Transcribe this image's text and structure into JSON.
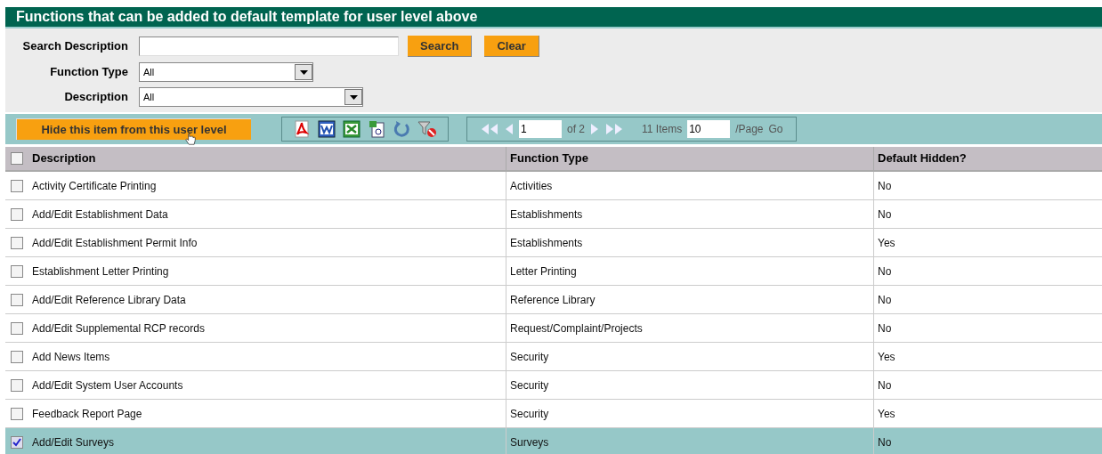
{
  "title": "Functions that can be added to default template for user level above",
  "search": {
    "label": "Search Description",
    "buttons": [
      "Search",
      "Clear"
    ]
  },
  "filters": [
    {
      "label": "Function Type",
      "value": "All"
    },
    {
      "label": "Description",
      "value": "All"
    }
  ],
  "toolbar": {
    "action": "Hide this item from this user level"
  },
  "pager": {
    "page": "1",
    "of": "of 2",
    "items": "11 Items",
    "page_size": "10",
    "per_page": "/Page",
    "go": "Go"
  },
  "table": {
    "select_all_checked": false,
    "columns": [
      "Description",
      "Function Type",
      "Default Hidden?"
    ],
    "rows": [
      {
        "description": "Activity Certificate Printing",
        "function_type": "Activities",
        "default_hidden": "No",
        "checked": false,
        "selected": false
      },
      {
        "description": "Add/Edit Establishment Data",
        "function_type": "Establishments",
        "default_hidden": "No",
        "checked": false,
        "selected": false
      },
      {
        "description": "Add/Edit Establishment Permit Info",
        "function_type": "Establishments",
        "default_hidden": "Yes",
        "checked": false,
        "selected": false
      },
      {
        "description": "Establishment Letter Printing",
        "function_type": "Letter Printing",
        "default_hidden": "No",
        "checked": false,
        "selected": false
      },
      {
        "description": "Add/Edit Reference Library Data",
        "function_type": "Reference Library",
        "default_hidden": "No",
        "checked": false,
        "selected": false
      },
      {
        "description": "Add/Edit Supplemental RCP records",
        "function_type": "Request/Complaint/Projects",
        "default_hidden": "No",
        "checked": false,
        "selected": false
      },
      {
        "description": "Add News Items",
        "function_type": "Security",
        "default_hidden": "Yes",
        "checked": false,
        "selected": false
      },
      {
        "description": "Add/Edit System User Accounts",
        "function_type": "Security",
        "default_hidden": "No",
        "checked": false,
        "selected": false
      },
      {
        "description": "Feedback Report Page",
        "function_type": "Security",
        "default_hidden": "Yes",
        "checked": false,
        "selected": false
      },
      {
        "description": "Add/Edit Surveys",
        "function_type": "Surveys",
        "default_hidden": "No",
        "checked": true,
        "selected": true
      }
    ]
  }
}
